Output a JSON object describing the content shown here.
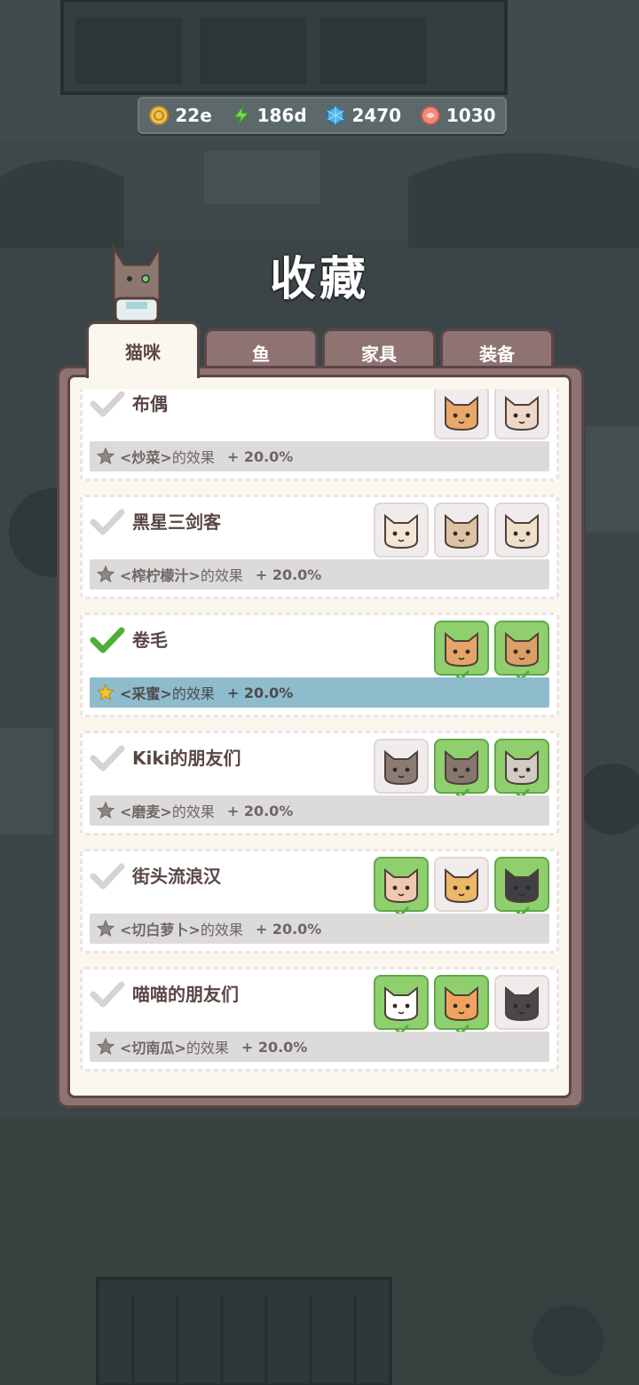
{
  "currency": [
    {
      "icon": "gold-coin-icon",
      "value": "22e"
    },
    {
      "icon": "lightning-icon",
      "value": "186d"
    },
    {
      "icon": "gem-icon",
      "value": "2470"
    },
    {
      "icon": "fish-cake-icon",
      "value": "1030"
    }
  ],
  "title": "收藏",
  "tabs": [
    "猫咪",
    "鱼",
    "家具",
    "装备"
  ],
  "active_tab": 0,
  "entries": [
    {
      "name": "布偶",
      "completed": false,
      "effect_tag": "<炒菜>",
      "effect_text": "的效果",
      "bonus": "+ 20.0%",
      "cats": [
        {
          "color": "#e9a86a",
          "owned": false
        },
        {
          "color": "#f0d8c8",
          "owned": false
        }
      ]
    },
    {
      "name": "黑星三剑客",
      "completed": false,
      "effect_tag": "<榨柠檬汁>",
      "effect_text": "的效果",
      "bonus": "+ 20.0%",
      "cats": [
        {
          "color": "#f2e6d6",
          "owned": false
        },
        {
          "color": "#dcc3a4",
          "owned": false
        },
        {
          "color": "#efe1c9",
          "owned": false
        }
      ]
    },
    {
      "name": "卷毛",
      "completed": true,
      "effect_tag": "<采蜜>",
      "effect_text": "的效果",
      "bonus": "+ 20.0%",
      "cats": [
        {
          "color": "#e6a46a",
          "owned": true
        },
        {
          "color": "#dca066",
          "owned": true
        }
      ]
    },
    {
      "name": "Kiki的朋友们",
      "completed": false,
      "effect_tag": "<磨麦>",
      "effect_text": "的效果",
      "bonus": "+ 20.0%",
      "cats": [
        {
          "color": "#8a7b74",
          "owned": false
        },
        {
          "color": "#86766d",
          "owned": true
        },
        {
          "color": "#d2cbc2",
          "owned": true
        }
      ]
    },
    {
      "name": "街头流浪汉",
      "completed": false,
      "effect_tag": "<切白萝卜>",
      "effect_text": "的效果",
      "bonus": "+ 20.0%",
      "cats": [
        {
          "color": "#f0c8b0",
          "owned": true
        },
        {
          "color": "#edb867",
          "owned": false
        },
        {
          "color": "#3f3f44",
          "owned": true
        }
      ]
    },
    {
      "name": "喵喵的朋友们",
      "completed": false,
      "effect_tag": "<切南瓜>",
      "effect_text": "的效果",
      "bonus": "+ 20.0%",
      "cats": [
        {
          "color": "#ffffff",
          "owned": true
        },
        {
          "color": "#f0a35e",
          "owned": true
        },
        {
          "color": "#4a4848",
          "owned": false
        }
      ]
    }
  ]
}
